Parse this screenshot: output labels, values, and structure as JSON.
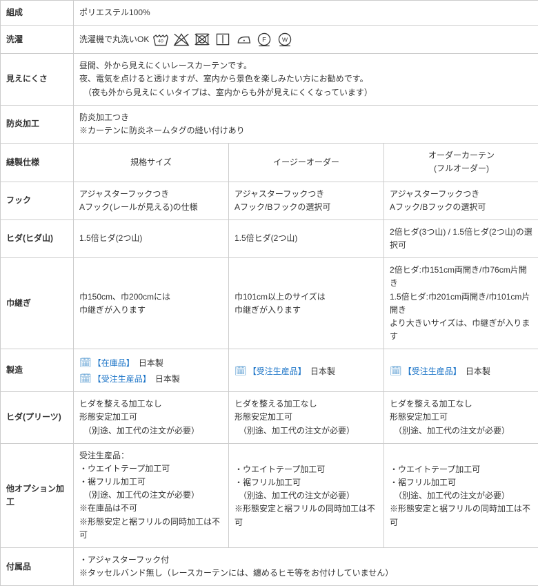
{
  "rows": {
    "composition": {
      "label": "組成",
      "value": "ポリエステル100%"
    },
    "wash": {
      "label": "洗濯",
      "text": "洗濯機で丸洗いOK"
    },
    "visibility": {
      "label": "見えにくさ",
      "line1": "昼間、外から見えにくいレースカーテンです。",
      "line2": "夜、電気を点けると透けますが、室内から景色を楽しみたい方にお勧めです。",
      "line3": "　（夜も外から見えにくいタイプは、室内からも外が見えにくくなっています）"
    },
    "fire": {
      "label": "防炎加工",
      "line1": "防炎加工つき",
      "line2": "※カーテンに防炎ネームタグの縫い付けあり"
    },
    "spec_heads": {
      "label": "縫製仕様",
      "c1": "規格サイズ",
      "c2": "イージーオーダー",
      "c3a": "オーダーカーテン",
      "c3b": "(フルオーダー)"
    },
    "hook": {
      "label": "フック",
      "c1a": "アジャスターフックつき",
      "c1b": "Aフック(レールが見える)の仕様",
      "c2a": "アジャスターフックつき",
      "c2b": "Aフック/Bフックの選択可",
      "c3a": "アジャスターフックつき",
      "c3b": "Aフック/Bフックの選択可"
    },
    "pleat": {
      "label": "ヒダ(ヒダ山)",
      "c1": "1.5倍ヒダ(2つ山)",
      "c2": "1.5倍ヒダ(2つ山)",
      "c3": "2倍ヒダ(3つ山) / 1.5倍ヒダ(2つ山)の選択可"
    },
    "seam": {
      "label": "巾継ぎ",
      "c1a": "巾150cm、巾200cmには",
      "c1b": "巾継ぎが入ります",
      "c2a": "巾101cm以上のサイズは",
      "c2b": "巾継ぎが入ります",
      "c3a": "2倍ヒダ:巾151cm両開き/巾76cm片開き",
      "c3b": "1.5倍ヒダ:巾201cm両開き/巾101cm片開き",
      "c3c": "より大きいサイズは、巾継ぎが入ります"
    },
    "manufacture": {
      "label": "製造",
      "badge_stock": "【在庫品】",
      "badge_order": "【受注生産品】",
      "jp": "日本製"
    },
    "pleat_finish": {
      "label": "ヒダ(プリーツ)",
      "l1": "ヒダを整える加工なし",
      "l2": "形態安定加工可",
      "l3": "　（別途、加工代の注文が必要）"
    },
    "options": {
      "label": "他オプション加工",
      "c1_l1": "受注生産品：",
      "c1_l2": "・ウエイトテープ加工可",
      "c1_l3": "・裾フリル加工可",
      "c1_l4": "　（別途、加工代の注文が必要）",
      "c1_l5": "※在庫品は不可",
      "c1_l6": "※形態安定と裾フリルの同時加工は不可",
      "c2_l1": "・ウエイトテープ加工可",
      "c2_l2": "・裾フリル加工可",
      "c2_l3": "　（別途、加工代の注文が必要）",
      "c2_l4": "※形態安定と裾フリルの同時加工は不可",
      "c3_l1": "・ウエイトテープ加工可",
      "c3_l2": "・裾フリル加工可",
      "c3_l3": "　（別途、加工代の注文が必要）",
      "c3_l4": "※形態安定と裾フリルの同時加工は不可"
    },
    "included": {
      "label": "付属品",
      "l1": "・アジャスターフック付",
      "l2": "※タッセルバンド無し（レースカーテンには、纏めるヒモ等をお付けしていません）"
    }
  }
}
